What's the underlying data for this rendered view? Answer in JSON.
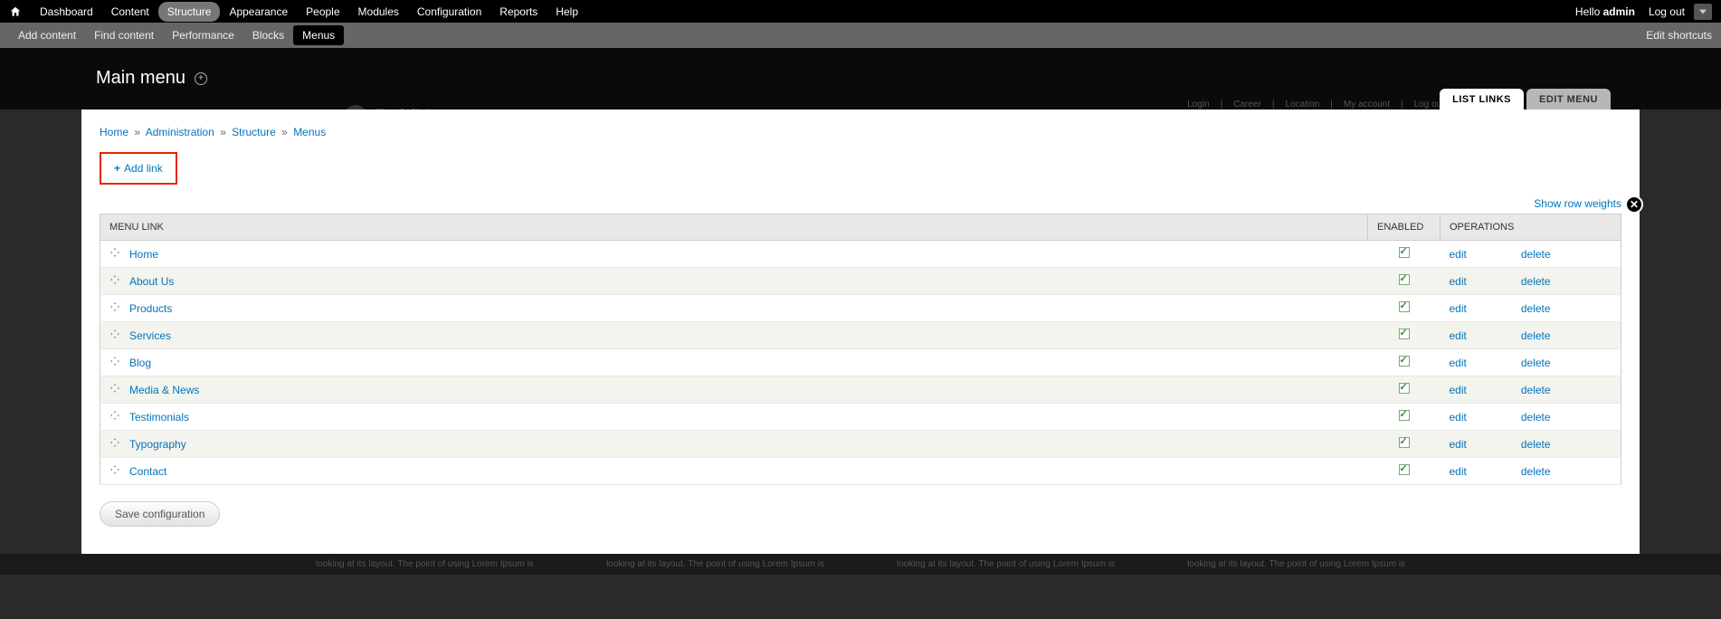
{
  "admin_menu": {
    "items": [
      "Dashboard",
      "Content",
      "Structure",
      "Appearance",
      "People",
      "Modules",
      "Configuration",
      "Reports",
      "Help"
    ],
    "active_index": 2,
    "hello_prefix": "Hello ",
    "username": "admin",
    "logout": "Log out"
  },
  "shortcut_bar": {
    "items": [
      "Add content",
      "Find content",
      "Performance",
      "Blocks",
      "Menus"
    ],
    "active_index": 4,
    "edit": "Edit shortcuts"
  },
  "page": {
    "title": "Main menu",
    "brand": "RubiX"
  },
  "tabs": {
    "list": "LIST LINKS",
    "edit": "EDIT MENU"
  },
  "breadcrumb": {
    "home": "Home",
    "admin": "Administration",
    "structure": "Structure",
    "menus": "Menus"
  },
  "actions": {
    "add_link": "Add link",
    "show_row_weights": "Show row weights",
    "save": "Save configuration"
  },
  "table": {
    "headers": {
      "menu_link": "MENU LINK",
      "enabled": "ENABLED",
      "operations": "OPERATIONS"
    },
    "op_edit": "edit",
    "op_delete": "delete",
    "rows": [
      {
        "label": "Home",
        "enabled": true
      },
      {
        "label": "About Us",
        "enabled": true
      },
      {
        "label": "Products",
        "enabled": true
      },
      {
        "label": "Services",
        "enabled": true
      },
      {
        "label": "Blog",
        "enabled": true
      },
      {
        "label": "Media & News",
        "enabled": true
      },
      {
        "label": "Testimonials",
        "enabled": true
      },
      {
        "label": "Typography",
        "enabled": true
      },
      {
        "label": "Contact",
        "enabled": true
      }
    ]
  },
  "bg_nav": {
    "items": [
      "Login",
      "Career",
      "Location",
      "My account",
      "Log out"
    ]
  },
  "lorem": "looking at its layout. The point of using Lorem Ipsum is"
}
